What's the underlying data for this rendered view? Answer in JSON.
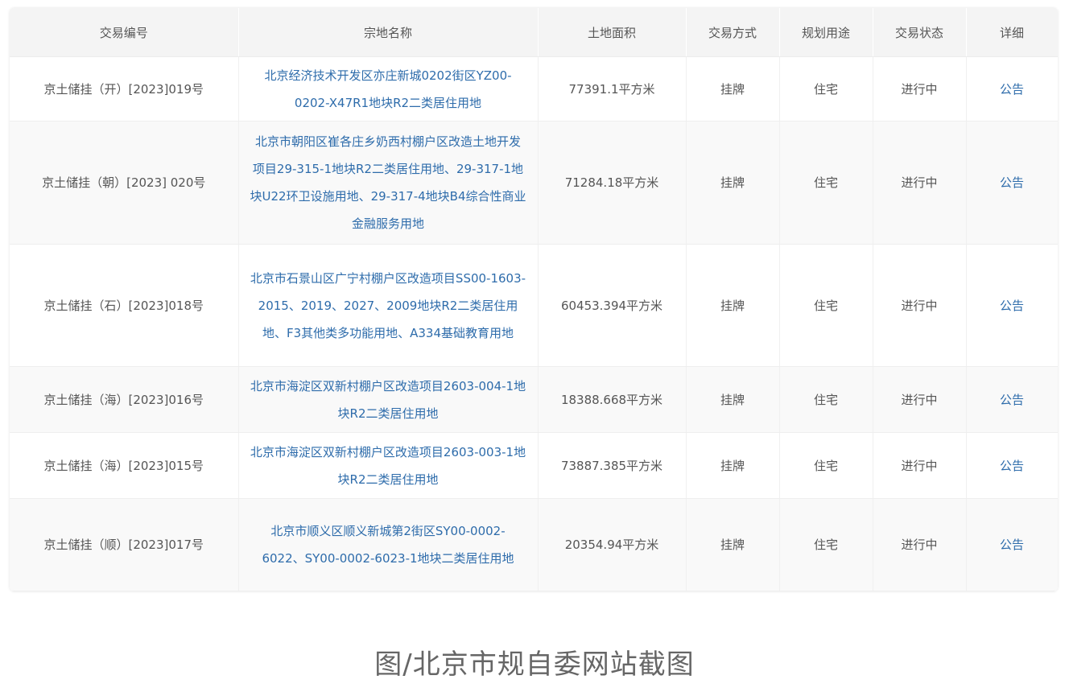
{
  "table": {
    "headers": [
      "交易编号",
      "宗地名称",
      "土地面积",
      "交易方式",
      "规划用途",
      "交易状态",
      "详细"
    ],
    "rows": [
      {
        "id": "京土储挂（开）[2023]019号",
        "name": "北京经济技术开发区亦庄新城0202街区YZ00-0202-X47R1地块R2二类居住用地",
        "area": "77391.1平方米",
        "method": "挂牌",
        "use": "住宅",
        "status": "进行中",
        "detail": "公告"
      },
      {
        "id": "京土储挂（朝）[2023] 020号",
        "name": "北京市朝阳区崔各庄乡奶西村棚户区改造土地开发项目29-315-1地块R2二类居住用地、29-317-1地块U22环卫设施用地、29-317-4地块B4综合性商业金融服务用地",
        "area": "71284.18平方米",
        "method": "挂牌",
        "use": "住宅",
        "status": "进行中",
        "detail": "公告"
      },
      {
        "id": "京土储挂（石）[2023]018号",
        "name": "北京市石景山区广宁村棚户区改造项目SS00-1603-2015、2019、2027、2009地块R2二类居住用地、F3其他类多功能用地、A334基础教育用地",
        "area": "60453.394平方米",
        "method": "挂牌",
        "use": "住宅",
        "status": "进行中",
        "detail": "公告"
      },
      {
        "id": "京土储挂（海）[2023]016号",
        "name": "北京市海淀区双新村棚户区改造项目2603-004-1地块R2二类居住用地",
        "area": "18388.668平方米",
        "method": "挂牌",
        "use": "住宅",
        "status": "进行中",
        "detail": "公告"
      },
      {
        "id": "京土储挂（海）[2023]015号",
        "name": "北京市海淀区双新村棚户区改造项目2603-003-1地块R2二类居住用地",
        "area": "73887.385平方米",
        "method": "挂牌",
        "use": "住宅",
        "status": "进行中",
        "detail": "公告"
      },
      {
        "id": "京土储挂（顺）[2023]017号",
        "name": "北京市顺义区顺义新城第2街区SY00-0002-6022、SY00-0002-6023-1地块二类居住用地",
        "area": "20354.94平方米",
        "method": "挂牌",
        "use": "住宅",
        "status": "进行中",
        "detail": "公告"
      }
    ]
  },
  "caption": "图/北京市规自委网站截图",
  "colors": {
    "link": "#2e6cab",
    "header_bg": "#f4f4f4",
    "row_alt_bg": "#f9f9f9",
    "text": "#555555"
  }
}
